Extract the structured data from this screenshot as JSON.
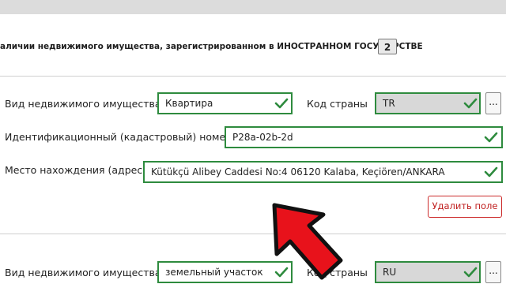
{
  "section": {
    "title": "аличии недвижимого имущества, зарегистрированном в ИНОСТРАННОМ ГОСУДАРСТВЕ",
    "count": "2"
  },
  "record1": {
    "property_type_label": "Вид недвижимого имущества",
    "property_type_value": "Квартира",
    "country_code_label": "Код страны",
    "country_code_value": "TR",
    "cadastral_label": "Идентификационный (кадастровый) номер",
    "cadastral_value": "P28a-02b-2d",
    "address_label": "Место нахождения (адрес)",
    "address_value": "Kütükçü Alibey Caddesi No:4 06120 Kalaba, Keçiören/ANKARA",
    "delete_label": "Удалить поле"
  },
  "record2": {
    "property_type_label": "Вид недвижимого имущества",
    "property_type_value": "земельный участок",
    "country_code_label": "Код страны",
    "country_code_value": "RU"
  },
  "ui": {
    "dots_label": "...",
    "valid_color": "#2e8b3e",
    "danger_color": "#cc2b2b",
    "arrow_color": "#e8121b",
    "icons": [
      "check-icon",
      "more-dots-icon",
      "pointer-arrow-icon"
    ]
  }
}
